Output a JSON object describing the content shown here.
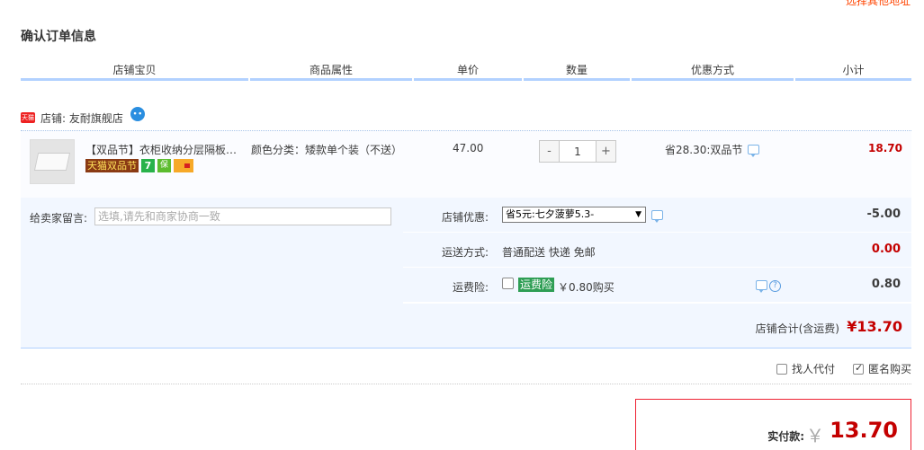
{
  "top_link": "选择其他地址",
  "page_title": "确认订单信息",
  "columns": [
    "店铺宝贝",
    "商品属性",
    "单价",
    "数量",
    "优惠方式",
    "小计"
  ],
  "shop": {
    "logo_text": "天猫",
    "label": "店铺: 友耐旗舰店",
    "wangwang_icon": "chat-bubble-icon"
  },
  "item": {
    "title": "【双品节】衣柜收纳分层隔板宿舍神器",
    "badge_event": "天猫双品节",
    "badge_7": "7",
    "badge_shield": "保",
    "attr": "颜色分类：矮款单个装（不送）",
    "price": "47.00",
    "qty_minus": "-",
    "qty_value": "1",
    "qty_plus": "+",
    "discount": "省28.30:双品节",
    "subtotal": "18.70"
  },
  "memo": {
    "label": "给卖家留言:",
    "placeholder": "选填,请先和商家协商一致"
  },
  "options": {
    "shop_discount_label": "店铺优惠:",
    "shop_discount_value": "省5元:七夕菠萝5.3-",
    "shop_discount_amount": "-5.00",
    "shipping_label": "运送方式:",
    "shipping_value": "普通配送 快递 免邮",
    "shipping_amount": "0.00",
    "insurance_label": "运费险:",
    "insurance_tag": "运费险",
    "insurance_price": "￥0.80购买",
    "insurance_amount": "0.80"
  },
  "shop_total": {
    "label": "店铺合计(含运费)",
    "value": "¥13.70"
  },
  "extras": {
    "proxy_pay": "找人代付",
    "anonymous": "匿名购买"
  },
  "payment": {
    "label": "实付款:",
    "yen": "￥",
    "value": "13.70"
  },
  "colors": {
    "price_red": "#c40000",
    "header_line": "#b2d1ff",
    "panel_bg": "#f2f7ff"
  }
}
